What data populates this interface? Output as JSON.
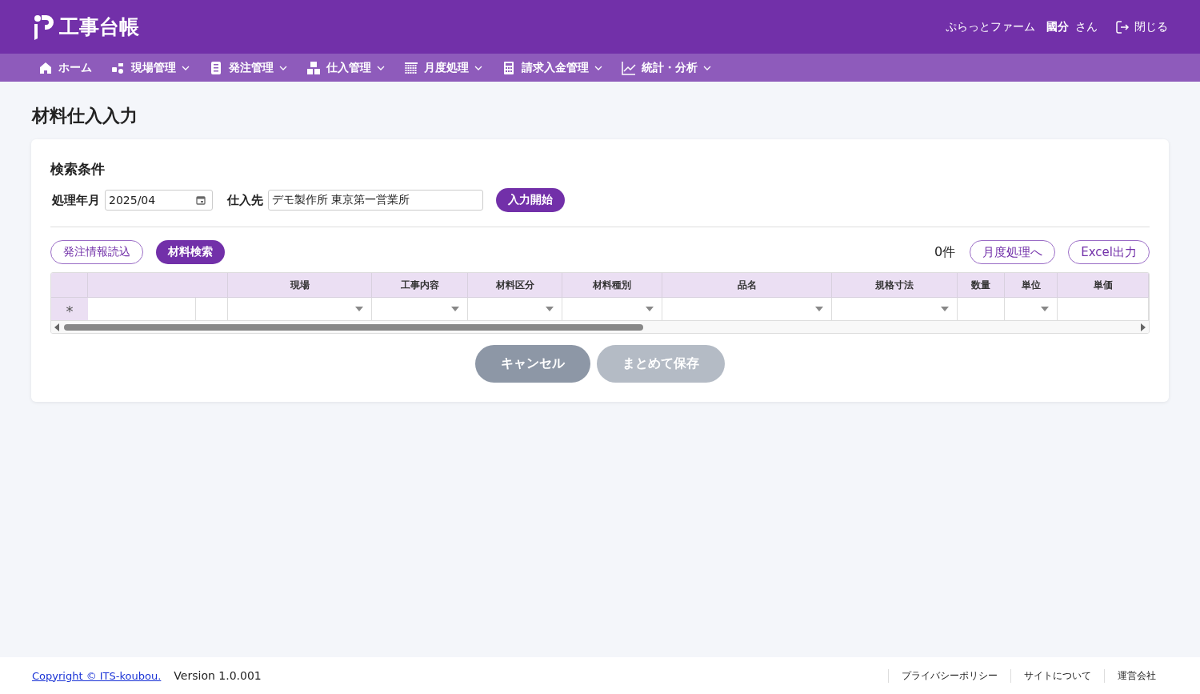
{
  "header": {
    "app_title": "工事台帳",
    "company": "ぷらっとファーム",
    "user_name": "國分",
    "user_suffix": "さん",
    "logout": "閉じる"
  },
  "nav": [
    {
      "label": "ホーム",
      "kind": "home",
      "dropdown": false
    },
    {
      "label": "現場管理",
      "kind": "site",
      "dropdown": true
    },
    {
      "label": "発注管理",
      "kind": "order",
      "dropdown": true
    },
    {
      "label": "仕入管理",
      "kind": "boxes",
      "dropdown": true
    },
    {
      "label": "月度処理",
      "kind": "calendar",
      "dropdown": true
    },
    {
      "label": "請求入金管理",
      "kind": "calculator",
      "dropdown": true
    },
    {
      "label": "統計・分析",
      "kind": "chart",
      "dropdown": true
    }
  ],
  "page_title": "材料仕入入力",
  "search": {
    "title": "検索条件",
    "month_label": "処理年月",
    "month_value": "2025/04",
    "supplier_label": "仕入先",
    "supplier_value": "デモ製作所 東京第一営業所",
    "start_button": "入力開始"
  },
  "toolbar": {
    "left_buttons": [
      {
        "label": "発注情報読込",
        "primary": false
      },
      {
        "label": "材料検索",
        "primary": true
      }
    ],
    "count": "0件",
    "right_buttons": [
      "月度処理へ",
      "Excel出力"
    ]
  },
  "table": {
    "columns": [
      "現場",
      "工事内容",
      "材料区分",
      "材料種別",
      "品名",
      "規格寸法",
      "数量",
      "単位",
      "単価"
    ],
    "row": {
      "marker": "*",
      "cells": [
        {
          "kind": "input"
        },
        {
          "kind": "input"
        },
        {
          "kind": "select"
        },
        {
          "kind": "select"
        },
        {
          "kind": "select"
        },
        {
          "kind": "select"
        },
        {
          "kind": "select"
        },
        {
          "kind": "select"
        },
        {
          "kind": "input"
        },
        {
          "kind": "select"
        },
        {
          "kind": "input"
        }
      ]
    }
  },
  "actions": [
    {
      "label": "キャンセル",
      "disabled": false
    },
    {
      "label": "まとめて保存",
      "disabled": true
    }
  ],
  "footer": {
    "copyright": "Copyright © ITS-koubou.",
    "version": "Version 1.0.001",
    "links": [
      "プライバシーポリシー",
      "サイトについて",
      "運営会社"
    ]
  }
}
